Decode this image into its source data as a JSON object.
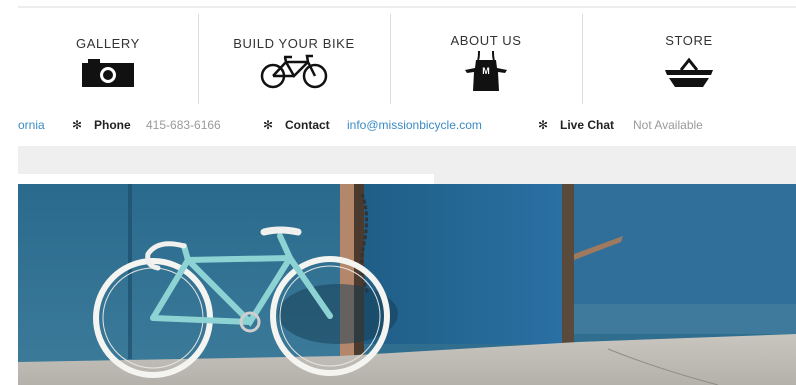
{
  "nav": {
    "items": [
      {
        "label": "GALLERY",
        "icon": "camera-icon"
      },
      {
        "label": "BUILD YOUR BIKE",
        "icon": "bicycle-icon"
      },
      {
        "label": "ABOUT US",
        "icon": "apron-icon"
      },
      {
        "label": "STORE",
        "icon": "basket-icon"
      }
    ],
    "apron_letter": "M"
  },
  "info_bar": {
    "location_fragment": "ornia",
    "phone_label": "Phone",
    "phone_value": "415-683-6166",
    "contact_label": "Contact",
    "contact_value": "info@missionbicycle.com",
    "chat_label": "Live Chat",
    "chat_value": "Not Available"
  },
  "colors": {
    "link": "#3b8bc4",
    "muted": "#9a9a9a",
    "door_blue": "#2d6a8d",
    "bike_frame": "#8ed3d3"
  }
}
